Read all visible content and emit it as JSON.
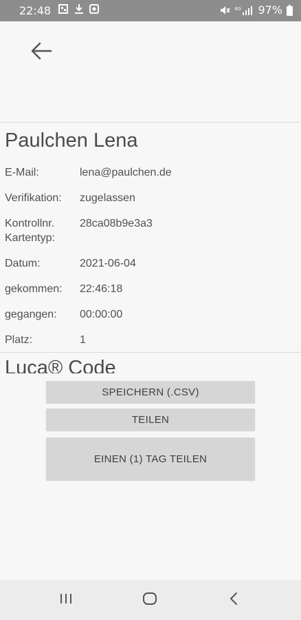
{
  "status_bar": {
    "time": "22:48",
    "battery": "97%",
    "left_icons": [
      "notification-icon",
      "download-icon",
      "screenshot-icon"
    ],
    "right_icons": [
      "mute-icon",
      "signal-icon",
      "battery-icon"
    ]
  },
  "header": {
    "back_icon": "arrow-left-icon"
  },
  "contact": {
    "name": "Paulchen Lena",
    "rows": [
      {
        "label": "E-Mail:",
        "value": "lena@paulchen.de"
      },
      {
        "label": "Verifikation:",
        "value": "zugelassen"
      },
      {
        "label": "Kontrollnr.\nKartentyp:",
        "value": "28ca08b9e3a3"
      },
      {
        "label": "Datum:",
        "value": "2021-06-04"
      },
      {
        "label": "gekommen:",
        "value": "22:46:18"
      },
      {
        "label": "gegangen:",
        "value": "00:00:00"
      },
      {
        "label": "Platz:",
        "value": "1"
      }
    ]
  },
  "code_section": {
    "heading": "Luca® Code"
  },
  "actions": {
    "save_csv": "SPEICHERN (.CSV)",
    "share": "TEILEN",
    "share_one_day": "EINEN (1) TAG TEILEN"
  },
  "nav_bar": {
    "icons": [
      "recent-apps-icon",
      "home-icon",
      "back-icon"
    ]
  },
  "colors": {
    "status_bar": "#8d8d8d",
    "background": "#f7f7f7",
    "button": "#d6d6d6",
    "nav_bar": "#ececec"
  }
}
